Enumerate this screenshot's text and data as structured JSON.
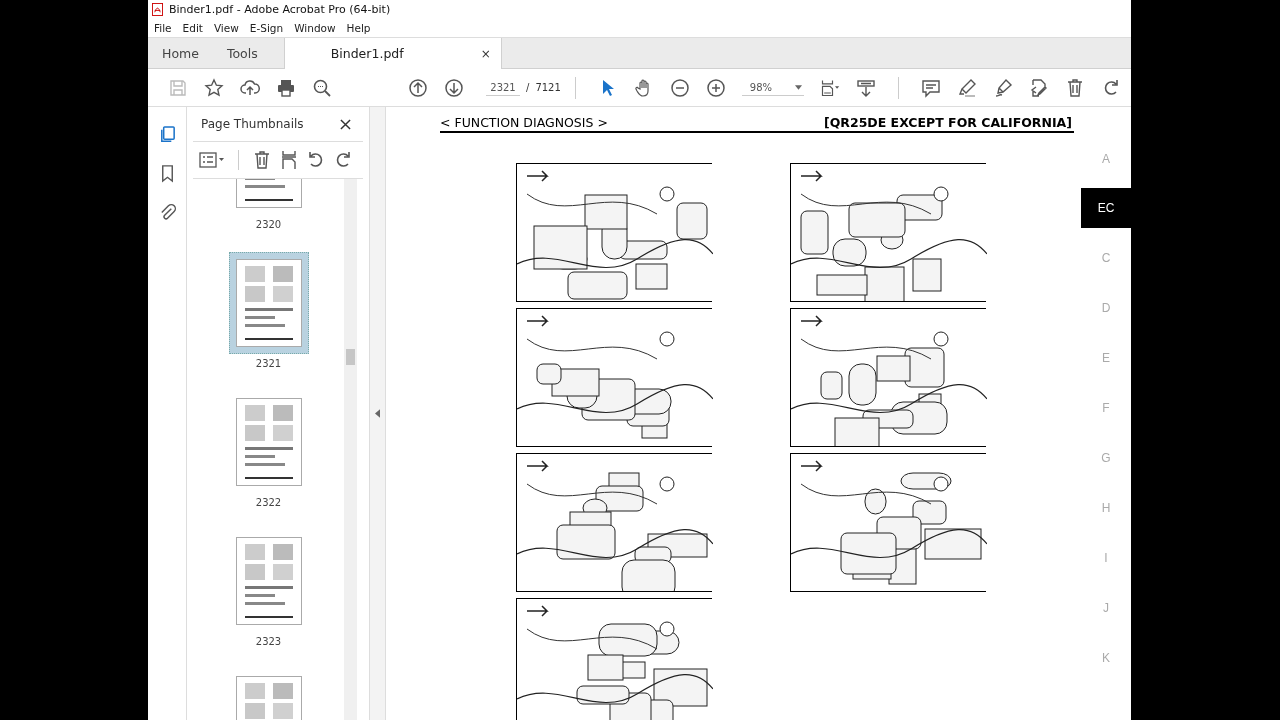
{
  "window": {
    "title": "Binder1.pdf - Adobe Acrobat Pro (64-bit)"
  },
  "menu": [
    "File",
    "Edit",
    "View",
    "E-Sign",
    "Window",
    "Help"
  ],
  "tabs": [
    {
      "label": "Home",
      "selected": false
    },
    {
      "label": "Tools",
      "selected": false
    },
    {
      "label": "Binder1.pdf",
      "selected": true,
      "close": "×"
    }
  ],
  "toolbar": {
    "page_current": "2321",
    "page_separator": "/",
    "page_total": "7121",
    "zoom": "98%"
  },
  "sidebar": {
    "title": "Page Thumbnails",
    "thumbnails": [
      {
        "label": "2320",
        "selected": false
      },
      {
        "label": "2321",
        "selected": true
      },
      {
        "label": "2322",
        "selected": false
      },
      {
        "label": "2323",
        "selected": false
      },
      {
        "selected": false
      }
    ]
  },
  "document": {
    "section": "< FUNCTION DIAGNOSIS >",
    "model": "[QR25DE EXCEPT FOR CALIFORNIA]",
    "index_tabs": [
      {
        "label": "A",
        "selected": false
      },
      {
        "label": "EC",
        "selected": true
      },
      {
        "label": "C",
        "selected": false
      },
      {
        "label": "D",
        "selected": false
      },
      {
        "label": "E",
        "selected": false
      },
      {
        "label": "F",
        "selected": false
      },
      {
        "label": "G",
        "selected": false
      },
      {
        "label": "H",
        "selected": false
      },
      {
        "label": "I",
        "selected": false
      },
      {
        "label": "J",
        "selected": false
      },
      {
        "label": "K",
        "selected": false
      }
    ]
  }
}
